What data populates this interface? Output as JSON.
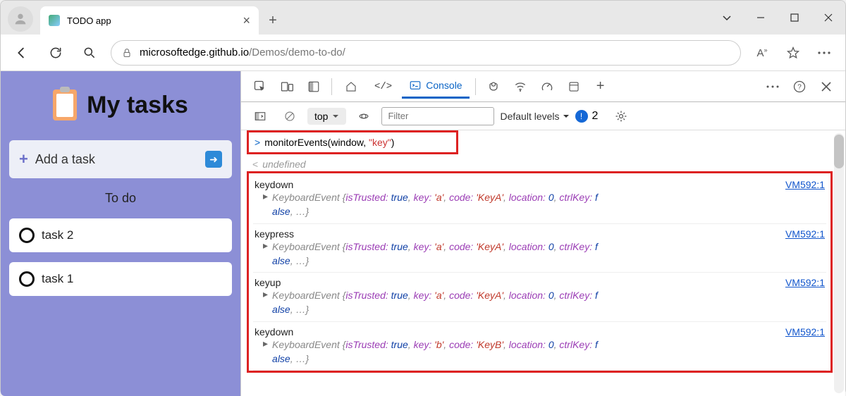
{
  "window": {
    "tab_title": "TODO app"
  },
  "toolbar": {
    "url_domain": "microsoftedge.github.io",
    "url_path": "/Demos/demo-to-do/"
  },
  "app": {
    "title": "My tasks",
    "add_label": "Add a task",
    "section_label": "To do",
    "tasks": [
      "task 2",
      "task 1"
    ]
  },
  "devtools": {
    "active_tab": "Console",
    "frame": "top",
    "filter_placeholder": "Filter",
    "levels_label": "Default levels",
    "issues_count": "2",
    "command": "monitorEvents(window, ",
    "command_str": "\"key\"",
    "command_end": ")",
    "return_value": "undefined",
    "source_ref": "VM592:1",
    "events": [
      {
        "name": "keydown",
        "key": "'a'",
        "code": "'KeyA'"
      },
      {
        "name": "keypress",
        "key": "'a'",
        "code": "'KeyA'"
      },
      {
        "name": "keyup",
        "key": "'a'",
        "code": "'KeyA'"
      },
      {
        "name": "keydown",
        "key": "'b'",
        "code": "'KeyB'"
      }
    ],
    "ev_template": {
      "class": "KeyboardEvent",
      "isTrusted": "true",
      "location": "0",
      "ctrlKey": "false",
      "keyLabel": "key:",
      "codeLabel": "code:",
      "isTrustedLabel": "isTrusted:",
      "locationLabel": "location:",
      "ctrlKeyLabel": "ctrlKey:"
    }
  }
}
